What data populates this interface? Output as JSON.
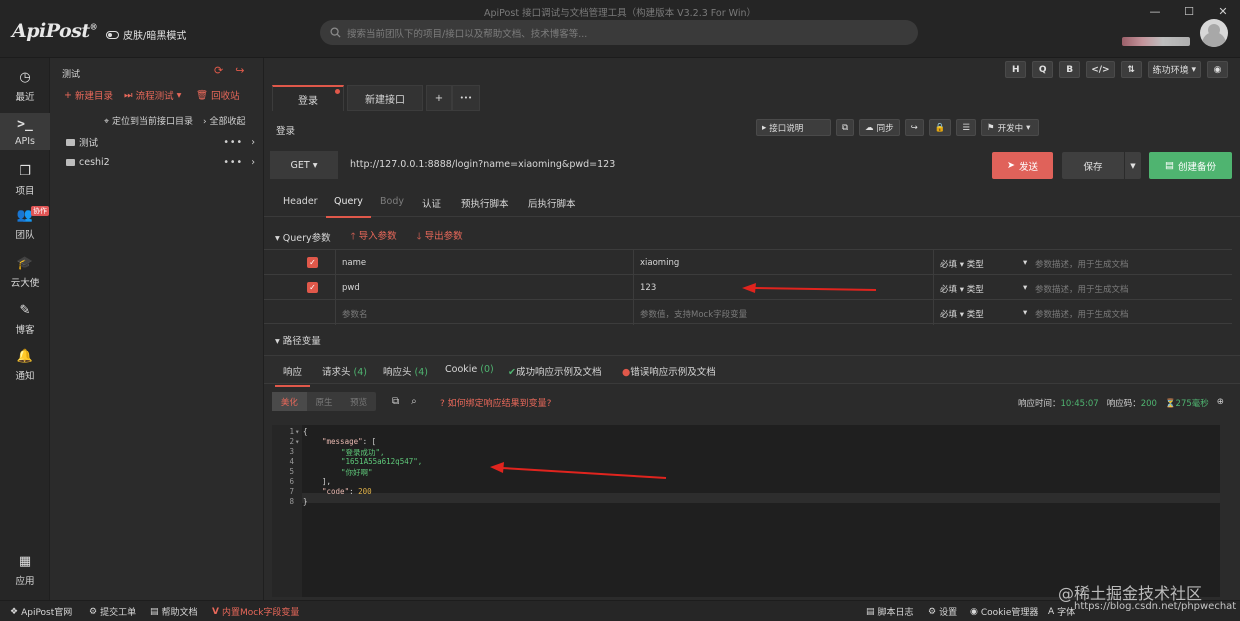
{
  "window": {
    "title": "ApiPost 接口调试与文档管理工具（构建版本 V3.2.3 For Win）",
    "logo": "ApiPost",
    "logo_mark": "®",
    "theme_toggle": "皮肤/暗黑模式",
    "search_placeholder": "搜索当前团队下的项目/接口以及帮助文档、技术博客等..."
  },
  "rail": {
    "items": [
      {
        "label": "最近",
        "icon": "clock-icon"
      },
      {
        "label": "APIs",
        "icon": "terminal-icon"
      },
      {
        "label": "项目",
        "icon": "project-icon"
      },
      {
        "label": "团队",
        "icon": "team-icon",
        "badge": "协作"
      },
      {
        "label": "云大使",
        "icon": "mortarboard-icon"
      },
      {
        "label": "博客",
        "icon": "edit-icon"
      },
      {
        "label": "通知",
        "icon": "bell-icon"
      },
      {
        "label": "应用",
        "icon": "apps-icon"
      }
    ]
  },
  "tree": {
    "project": "测试",
    "new_dir": "新建目录",
    "flow_test": "流程测试",
    "recycle": "回收站",
    "locate": "定位到当前接口目录",
    "collapse_all": "全部收起",
    "folders": [
      {
        "name": "测试",
        "more": "•••",
        "arrow": "›"
      },
      {
        "name": "ceshi2",
        "more": "•••",
        "arrow": "›"
      }
    ]
  },
  "top_right": {
    "buttons": [
      "H",
      "Q",
      "B",
      "</>",
      "⇅"
    ],
    "env": "练功环境",
    "eye": "◉"
  },
  "tabs": [
    {
      "label": "登录",
      "active": true
    },
    {
      "label": "新建接口",
      "active": false
    }
  ],
  "tab_add": "+",
  "tab_more": "•••",
  "api": {
    "title": "登录",
    "tools": {
      "doc": "接口说明",
      "sync": "同步",
      "status": "开发中"
    },
    "method": "GET",
    "url": "http://127.0.0.1:8888/login?name=xiaoming&pwd=123",
    "send": "发送",
    "save": "保存",
    "backup": "创建备份"
  },
  "request_tabs": [
    "Header",
    "Query",
    "Body",
    "认证",
    "预执行脚本",
    "后执行脚本"
  ],
  "query": {
    "title": "Query参数",
    "import": "导入参数",
    "export": "导出参数",
    "rows": [
      {
        "key": "name",
        "value": "xiaoming",
        "required": "必填",
        "type": "类型",
        "desc": "参数描述，用于生成文档"
      },
      {
        "key": "pwd",
        "value": "123",
        "required": "必填",
        "type": "类型",
        "desc": "参数描述，用于生成文档"
      }
    ],
    "empty_row": {
      "key": "参数名",
      "value": "参数值，支持Mock字段变量",
      "required": "必填",
      "type": "类型",
      "desc": "参数描述，用于生成文档"
    }
  },
  "path_vars": "路径变量",
  "response_tabs": {
    "resp": "响应",
    "req_headers": "请求头",
    "req_headers_count": "(4)",
    "resp_headers": "响应头",
    "resp_headers_count": "(4)",
    "cookie": "Cookie",
    "cookie_count": "(0)",
    "success_example": "成功响应示例及文档",
    "error_example": "错误响应示例及文档"
  },
  "response": {
    "formats": [
      "美化",
      "原生",
      "预览"
    ],
    "bind_link": "如何绑定响应结果到变量?",
    "time_label": "响应时间：",
    "time": "10:45:07",
    "code_label": "响应码：",
    "code": "200",
    "duration": "275毫秒"
  },
  "code_lines": [
    "1",
    "2",
    "3",
    "4",
    "5",
    "6",
    "7",
    "8"
  ],
  "code_text": {
    "l1": "{",
    "l2_key": "\"message\"",
    "l2_rest": ": [",
    "l3": "\"登录成功\",",
    "l4": "\"1651A55a612q547\",",
    "l5": "\"你好啊\"",
    "l6": "],",
    "l7_key": "\"code\"",
    "l7_colon": ": ",
    "l7_val": "200",
    "l8": "}"
  },
  "status_bar": {
    "official": "ApiPost官网",
    "ticket": "提交工单",
    "help": "帮助文档",
    "mock": "内置Mock字段变量",
    "log": "脚本日志",
    "settings": "设置",
    "cookie": "Cookie管理器",
    "font": "字体"
  },
  "watermark": "@稀土掘金技术社区",
  "watermark_url": "https://blog.csdn.net/phpwechat",
  "colors": {
    "accent": "#e0584a",
    "send": "#e0625a",
    "backup": "#4fb470",
    "success": "#4fb470"
  }
}
